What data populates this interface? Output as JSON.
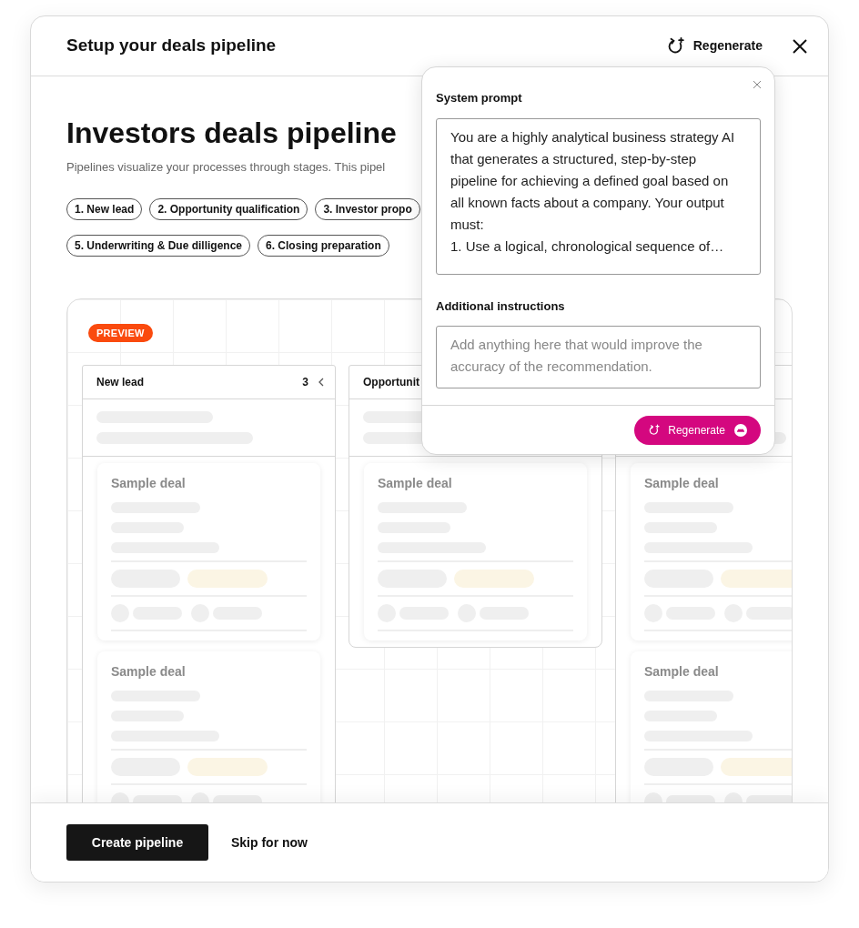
{
  "dialog": {
    "title": "Setup your deals pipeline",
    "header_action": "Regenerate"
  },
  "pipeline": {
    "title": "Investors deals pipeline",
    "description": "Pipelines visualize your processes through stages. This pipel",
    "stage_rows": [
      [
        "1. New lead",
        "2. Opportunity qualification",
        "3. Investor propo"
      ],
      [
        "5. Underwriting & Due dilligence",
        "6. Closing preparation"
      ]
    ]
  },
  "preview": {
    "badge": "PREVIEW",
    "columns": [
      {
        "name": "New lead",
        "count": "3",
        "cards": [
          "Sample deal",
          "Sample deal"
        ]
      },
      {
        "name": "Opportunit",
        "cards": [
          "Sample deal"
        ]
      },
      {
        "cards": [
          "Sample deal",
          "Sample deal"
        ]
      }
    ]
  },
  "popover": {
    "system_prompt_label": "System prompt",
    "system_prompt": "You are a highly analytical business strategy AI that generates a structured, step-by-step pipeline for achieving a defined goal based on all known facts about a company. Your output must:\n1. Use a logical, chronological sequence of…",
    "additional_label": "Additional instructions",
    "additional_placeholder": "Add anything here that would improve the accuracy of the recommendation.",
    "button": "Regenerate"
  },
  "footer": {
    "primary": "Create pipeline",
    "secondary": "Skip for now"
  }
}
